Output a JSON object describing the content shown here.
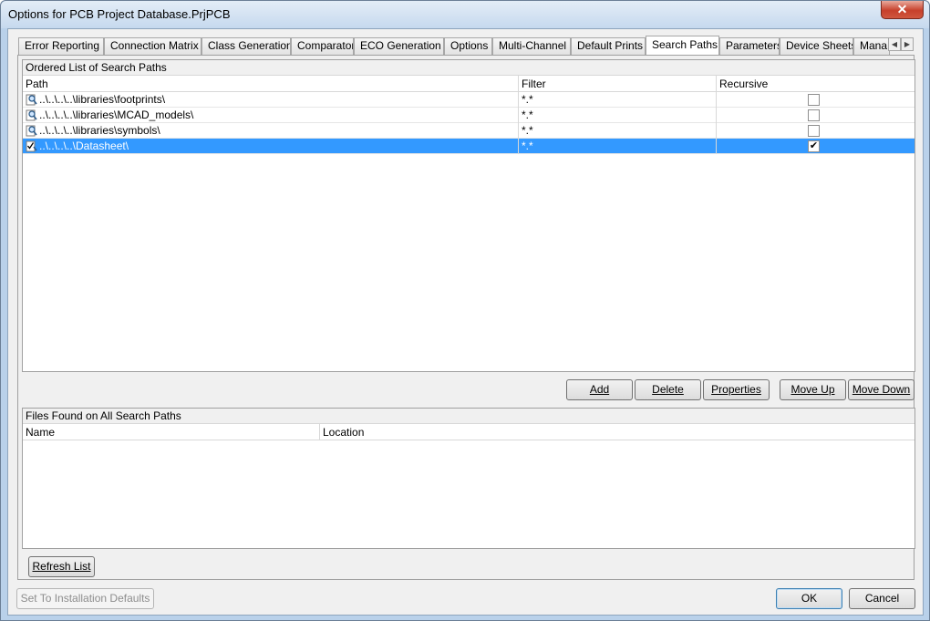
{
  "window": {
    "title": "Options for PCB Project Database.PrjPCB",
    "close_symbol": "✕"
  },
  "tabs": [
    {
      "label": "Error Reporting"
    },
    {
      "label": "Connection Matrix"
    },
    {
      "label": "Class Generation"
    },
    {
      "label": "Comparator"
    },
    {
      "label": "ECO Generation"
    },
    {
      "label": "Options"
    },
    {
      "label": "Multi-Channel"
    },
    {
      "label": "Default Prints"
    },
    {
      "label": "Search Paths",
      "active": true
    },
    {
      "label": "Parameters"
    },
    {
      "label": "Device Sheets"
    },
    {
      "label": "Mana"
    }
  ],
  "tab_scroll": {
    "left": "◀",
    "right": "▶"
  },
  "search_paths": {
    "group_title": "Ordered List of Search Paths",
    "columns": {
      "path": "Path",
      "filter": "Filter",
      "recursive": "Recursive"
    },
    "rows": [
      {
        "path": "..\\..\\..\\..\\libraries\\footprints\\",
        "filter": "*.*",
        "recursive": false,
        "selected": false,
        "icon": "search-path-icon"
      },
      {
        "path": "..\\..\\..\\..\\libraries\\MCAD_models\\",
        "filter": "*.*",
        "recursive": false,
        "selected": false,
        "icon": "search-path-icon"
      },
      {
        "path": "..\\..\\..\\..\\libraries\\symbols\\",
        "filter": "*.*",
        "recursive": false,
        "selected": false,
        "icon": "search-path-icon"
      },
      {
        "path": "..\\..\\..\\..\\Datasheet\\",
        "filter": "*.*",
        "recursive": true,
        "selected": true,
        "icon": "search-path-icon"
      }
    ],
    "check_mark": "✔"
  },
  "buttons": {
    "add": "Add",
    "delete": "Delete",
    "properties": "Properties",
    "move_up": "Move Up",
    "move_down": "Move Down",
    "refresh": "Refresh List",
    "set_defaults": "Set To Installation Defaults",
    "ok": "OK",
    "cancel": "Cancel"
  },
  "files_found": {
    "group_title": "Files Found on All Search Paths",
    "columns": {
      "name": "Name",
      "location": "Location"
    }
  },
  "colors": {
    "selection": "#3399ff",
    "title_bar": "#c6d9ee",
    "close_button": "#c7402b"
  }
}
